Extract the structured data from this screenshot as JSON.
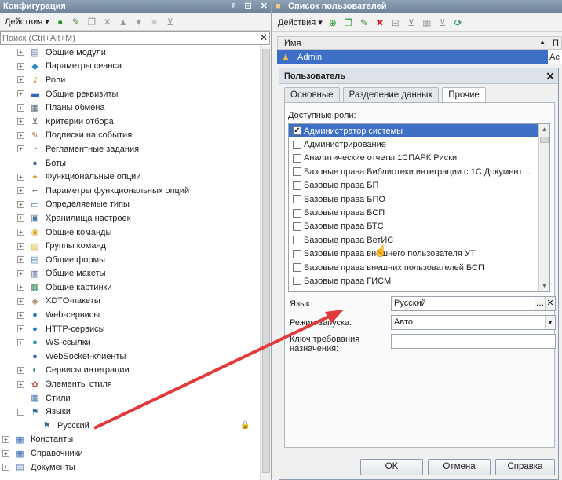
{
  "left_panel": {
    "title": "Конфигурация",
    "title_buttons": [
      "ᵖ",
      "⊡",
      "✕"
    ],
    "toolbar_actions_label": "Действия",
    "search_placeholder": "Поиск (Ctrl+Alt+M)",
    "tree": [
      {
        "label": "Общие модули",
        "icon": "module-icon",
        "color": "#5a7ab0",
        "level": 1,
        "expand": "+"
      },
      {
        "label": "Параметры сеанса",
        "icon": "session-params-icon",
        "color": "#2a8ad0",
        "level": 1,
        "expand": "+"
      },
      {
        "label": "Роли",
        "icon": "roles-key-icon",
        "color": "#c89a2a",
        "level": 1,
        "expand": "+"
      },
      {
        "label": "Общие реквизиты",
        "icon": "common-attributes-icon",
        "color": "#2a6ac0",
        "level": 1,
        "expand": "+"
      },
      {
        "label": "Планы обмена",
        "icon": "exchange-plans-icon",
        "color": "#5a6a7a",
        "level": 1,
        "expand": "+"
      },
      {
        "label": "Критерии отбора",
        "icon": "filter-criteria-icon",
        "color": "#6a6a6a",
        "level": 1,
        "expand": "+"
      },
      {
        "label": "Подписки на события",
        "icon": "event-subscription-icon",
        "color": "#c0682a",
        "level": 1,
        "expand": "+"
      },
      {
        "label": "Регламентные задания",
        "icon": "scheduled-jobs-icon",
        "color": "#3a7ac0",
        "level": 1,
        "expand": "+"
      },
      {
        "label": "Боты",
        "icon": "bots-icon",
        "color": "#4a6a9a",
        "level": 1,
        "expand": ""
      },
      {
        "label": "Функциональные опции",
        "icon": "functional-options-icon",
        "color": "#c09a2a",
        "level": 1,
        "expand": "+"
      },
      {
        "label": "Параметры функциональных опций",
        "icon": "functional-params-icon",
        "color": "#555555",
        "level": 1,
        "expand": "+"
      },
      {
        "label": "Определяемые типы",
        "icon": "defined-types-icon",
        "color": "#3a6ab0",
        "level": 1,
        "expand": "+"
      },
      {
        "label": "Хранилища настроек",
        "icon": "settings-storage-icon",
        "color": "#4a7aa0",
        "level": 1,
        "expand": "+"
      },
      {
        "label": "Общие команды",
        "icon": "common-commands-icon",
        "color": "#e0a020",
        "level": 1,
        "expand": "+"
      },
      {
        "label": "Группы команд",
        "icon": "command-groups-icon",
        "color": "#e0b030",
        "level": 1,
        "expand": "+"
      },
      {
        "label": "Общие формы",
        "icon": "common-forms-icon",
        "color": "#4a7ab0",
        "level": 1,
        "expand": "+"
      },
      {
        "label": "Общие макеты",
        "icon": "common-templates-icon",
        "color": "#4a6a9a",
        "level": 1,
        "expand": "+"
      },
      {
        "label": "Общие картинки",
        "icon": "common-pictures-icon",
        "color": "#3a8a5a",
        "level": 1,
        "expand": "+"
      },
      {
        "label": "XDTO-пакеты",
        "icon": "xdto-packages-icon",
        "color": "#8a6a3a",
        "level": 1,
        "expand": "+"
      },
      {
        "label": "Web-сервисы",
        "icon": "web-services-icon",
        "color": "#2a7ac0",
        "level": 1,
        "expand": "+"
      },
      {
        "label": "HTTP-сервисы",
        "icon": "http-services-icon",
        "color": "#2a7ac0",
        "level": 1,
        "expand": "+"
      },
      {
        "label": "WS-ссылки",
        "icon": "ws-links-icon",
        "color": "#2a8aa0",
        "level": 1,
        "expand": "+"
      },
      {
        "label": "WebSocket-клиенты",
        "icon": "websocket-clients-icon",
        "color": "#2a6ab0",
        "level": 1,
        "expand": ""
      },
      {
        "label": "Сервисы интеграции",
        "icon": "integration-services-icon",
        "color": "#3a9a5a",
        "level": 1,
        "expand": "+"
      },
      {
        "label": "Элементы стиля",
        "icon": "style-elements-icon",
        "color": "#c04a4a",
        "level": 1,
        "expand": "+"
      },
      {
        "label": "Стили",
        "icon": "styles-icon",
        "color": "#4a7ab0",
        "level": 1,
        "expand": ""
      },
      {
        "label": "Языки",
        "icon": "languages-icon",
        "color": "#3a6a9a",
        "level": 1,
        "expand": "−"
      },
      {
        "label": "Русский",
        "icon": "language-item-icon",
        "color": "#3a6a9a",
        "level": 2,
        "expand": "",
        "lock": true
      },
      {
        "label": "Константы",
        "icon": "constants-icon",
        "color": "#3a6ab0",
        "level": 0,
        "expand": "+"
      },
      {
        "label": "Справочники",
        "icon": "catalogs-icon",
        "color": "#3a6ab0",
        "level": 0,
        "expand": "+"
      },
      {
        "label": "Документы",
        "icon": "documents-icon",
        "color": "#5a7ab0",
        "level": 0,
        "expand": "+"
      }
    ]
  },
  "users_panel": {
    "title": "Список пользователей",
    "toolbar_actions_label": "Действия",
    "columns": [
      "Имя",
      "П"
    ],
    "rows": [
      {
        "name": "Admin",
        "col2": "Ac"
      }
    ]
  },
  "dialog": {
    "title": "Пользователь",
    "tabs": [
      "Основные",
      "Разделение данных",
      "Прочие"
    ],
    "active_tab": 2,
    "roles_label": "Доступные роли:",
    "roles": [
      {
        "label": "Администратор системы",
        "checked": true,
        "selected": true
      },
      {
        "label": "Администрирование",
        "checked": false
      },
      {
        "label": "Аналитические отчеты 1СПАРК Риски",
        "checked": false
      },
      {
        "label": "Базовые права Библиотеки интеграции с 1С:Документ…",
        "checked": false
      },
      {
        "label": "Базовые права БП",
        "checked": false
      },
      {
        "label": "Базовые права БПО",
        "checked": false
      },
      {
        "label": "Базовые права БСП",
        "checked": false
      },
      {
        "label": "Базовые права БТС",
        "checked": false
      },
      {
        "label": "Базовые права ВетИС",
        "checked": false
      },
      {
        "label": "Базовые права внешнего пользователя УТ",
        "checked": false
      },
      {
        "label": "Базовые права внешних пользователей БСП",
        "checked": false
      },
      {
        "label": "Базовые права ГИСМ",
        "checked": false
      }
    ],
    "language_label": "Язык:",
    "language_value": "Русский",
    "launch_mode_label": "Режим запуска:",
    "launch_mode_value": "Авто",
    "key_label_line1": "Ключ требования",
    "key_label_line2": "назначения:",
    "key_value": "",
    "buttons": {
      "ok": "OK",
      "cancel": "Отмена",
      "help": "Справка"
    }
  },
  "colors": {
    "selection": "#3d6fc7",
    "arrow": "#e03a3a",
    "title_bar": "#7a8ea5"
  }
}
